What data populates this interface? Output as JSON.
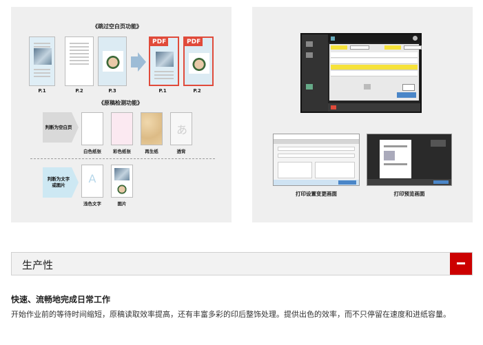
{
  "left_panel": {
    "skip_blank_title": "《跳过空白页功能》",
    "source_pages": [
      "P.1",
      "P.2",
      "P.3"
    ],
    "output_pages": [
      "P.1",
      "P.2"
    ],
    "pdf_tag": "PDF",
    "detect_title": "《原稿检测功能》",
    "blank_category": "判断为空白页",
    "blank_samples": [
      "白色纸张",
      "彩色纸张",
      "再生纸",
      "透背"
    ],
    "text_category": "判断为文字或图片",
    "content_samples": [
      "浅色文字",
      "图片"
    ],
    "light_text_glyph": "A"
  },
  "right_panel": {
    "captions": [
      "打印设置变更画面",
      "打印预览画面"
    ]
  },
  "accordion": {
    "title": "生产性",
    "toggle_symbol": "—"
  },
  "content": {
    "heading": "快速、流畅地完成日常工作",
    "body": "开始作业前的等待时间缩短，原稿读取效率提高，还有丰富多彩的印后整饰处理。提供出色的效率，而不只停留在速度和进纸容量。"
  },
  "colors": {
    "accent": "#cc0000",
    "pdf": "#e04a3a",
    "highlight": "#f6e23a"
  }
}
